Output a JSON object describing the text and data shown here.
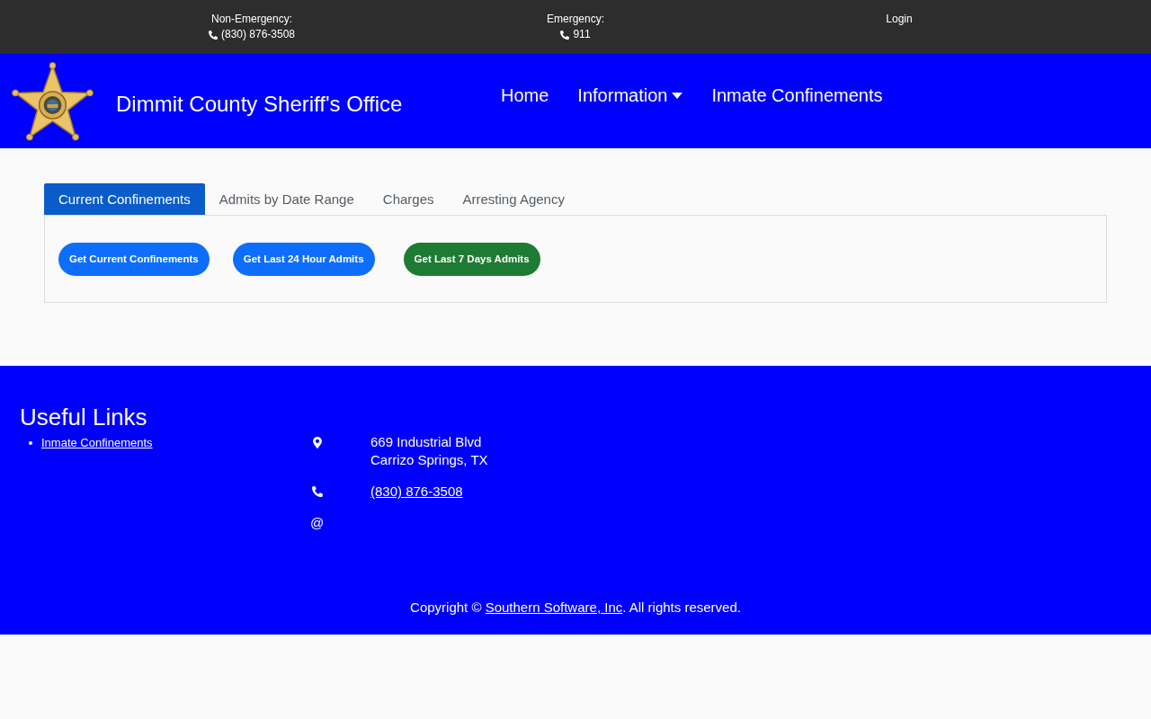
{
  "top_bar": {
    "contacts": [
      {
        "label": "Non-Emergency:",
        "phone": "(830) 876-3508"
      },
      {
        "label": "Emergency:",
        "phone": "911"
      }
    ],
    "login": "Login"
  },
  "header": {
    "title": "Dimmit County Sheriff's Office",
    "nav": [
      {
        "label": "Home",
        "kind": "link"
      },
      {
        "label": "Information",
        "kind": "dropdown"
      },
      {
        "label": "Inmate Confinements",
        "kind": "link"
      }
    ]
  },
  "tabs": [
    {
      "label": "Current Confinements",
      "selected": true
    },
    {
      "label": "Admits by Date Range",
      "selected": false
    },
    {
      "label": "Charges",
      "selected": false
    },
    {
      "label": "Arresting Agency",
      "selected": false
    }
  ],
  "actions": [
    {
      "label": "Get Current Confinements",
      "color": "#0d6efd"
    },
    {
      "label": "Get Last 24 Hour Admits",
      "color": "#0d6efd"
    },
    {
      "label": "Get Last 7 Days Admits",
      "color": "#1e7b34"
    }
  ],
  "footer": {
    "useful_links": {
      "title": "Useful Links",
      "links": [
        "Inmate Confinements"
      ]
    },
    "contact": [
      {
        "kind": "address",
        "lines": [
          "669 Industrial Blvd",
          "Carrizo Springs, TX"
        ]
      },
      {
        "kind": "phone",
        "link": "(830) 876-3508"
      },
      {
        "kind": "email",
        "symbol": "@"
      }
    ],
    "copyright": {
      "before": "Copyright ©",
      "link": "Southern Software, Inc",
      "after": ". All rights reserved."
    }
  }
}
